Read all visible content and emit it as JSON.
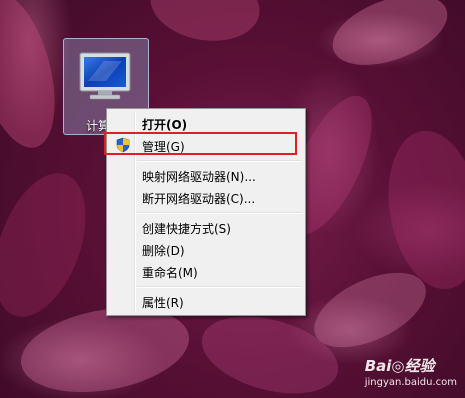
{
  "desktop": {
    "icon_label": "计算"
  },
  "context_menu": {
    "items": [
      {
        "label": "打开(O)",
        "bold": true
      },
      {
        "label": "管理(G)",
        "icon": "uac-shield-icon",
        "highlighted": true
      },
      {
        "label": "映射网络驱动器(N)..."
      },
      {
        "label": "断开网络驱动器(C)..."
      },
      {
        "label": "创建快捷方式(S)"
      },
      {
        "label": "删除(D)"
      },
      {
        "label": "重命名(M)"
      },
      {
        "label": "属性(R)"
      }
    ]
  },
  "watermark": {
    "logo": "Bai◎经验",
    "url": "jingyan.baidu.com"
  },
  "colors": {
    "highlight_box": "#e02020",
    "menu_background": "#f0f0f0"
  }
}
